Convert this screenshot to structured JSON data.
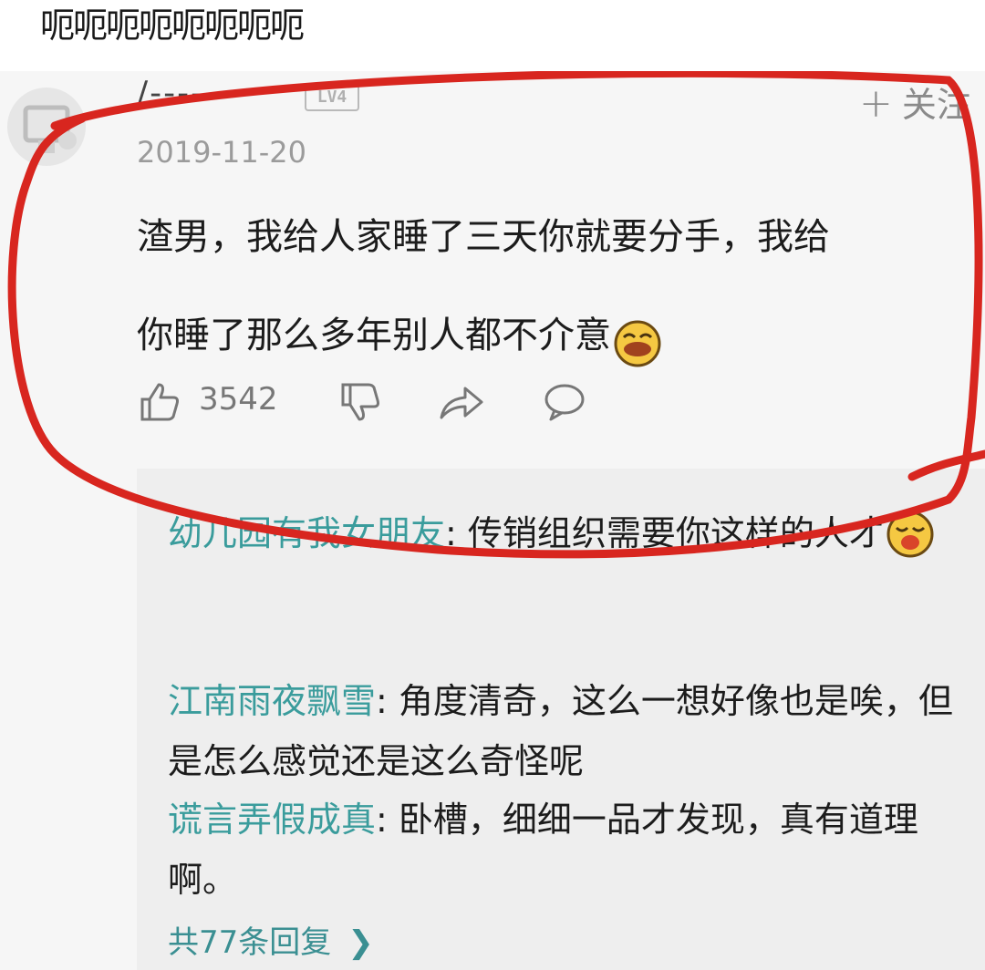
{
  "post": {
    "title": "呃呃呃呃呃呃呃呃"
  },
  "comment": {
    "username": "/-------",
    "level_badge": "LV4",
    "follow_label": "关注",
    "date": "2019-11-20",
    "text_line1": "渣男，我给人家睡了三天你就要分手，我给",
    "text_line2": "你睡了那么多年别人都不介意",
    "like_count": "3542"
  },
  "replies": [
    {
      "author": "幼儿园有我女朋友",
      "sep": ": ",
      "text": "传销组织需要你这样的人才"
    },
    {
      "author": "江南雨夜飘雪",
      "sep": ": ",
      "text": "角度清奇，这么一想好像也是唉，但是怎么感觉还是这么奇怪呢"
    },
    {
      "author": "谎言弄假成真",
      "sep": ": ",
      "text": "卧槽，细细一品才发现，真有道理啊。"
    }
  ],
  "replies_more": "共77条回复",
  "colors": {
    "annotation": "#d8261f",
    "reply_author": "#3a9c9c",
    "page_bg": "#f6f6f6",
    "replies_bg": "#eeeeee"
  },
  "icons": [
    "thumbs-up-icon",
    "thumbs-down-icon",
    "share-icon",
    "comment-icon",
    "chevron-right-icon",
    "plus-icon",
    "emoji-icon"
  ]
}
